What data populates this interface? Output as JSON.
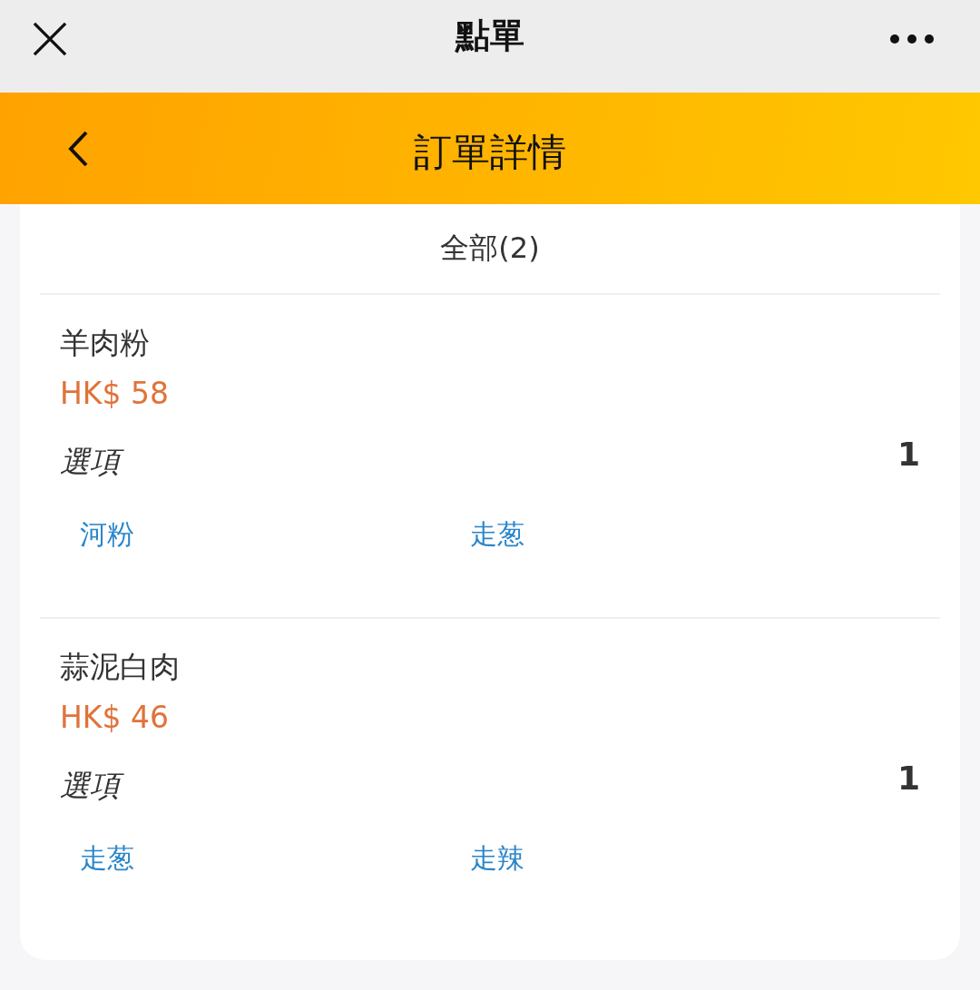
{
  "window": {
    "title": "點單"
  },
  "header": {
    "title": "訂單詳情"
  },
  "tab": {
    "label": "全部(2)"
  },
  "items": [
    {
      "name": "羊肉粉",
      "price": "HK$ 58",
      "options_label": "選項",
      "quantity": "1",
      "options": [
        "河粉",
        "走葱"
      ]
    },
    {
      "name": "蒜泥白肉",
      "price": "HK$ 46",
      "options_label": "選項",
      "quantity": "1",
      "options": [
        "走葱",
        "走辣"
      ]
    }
  ]
}
